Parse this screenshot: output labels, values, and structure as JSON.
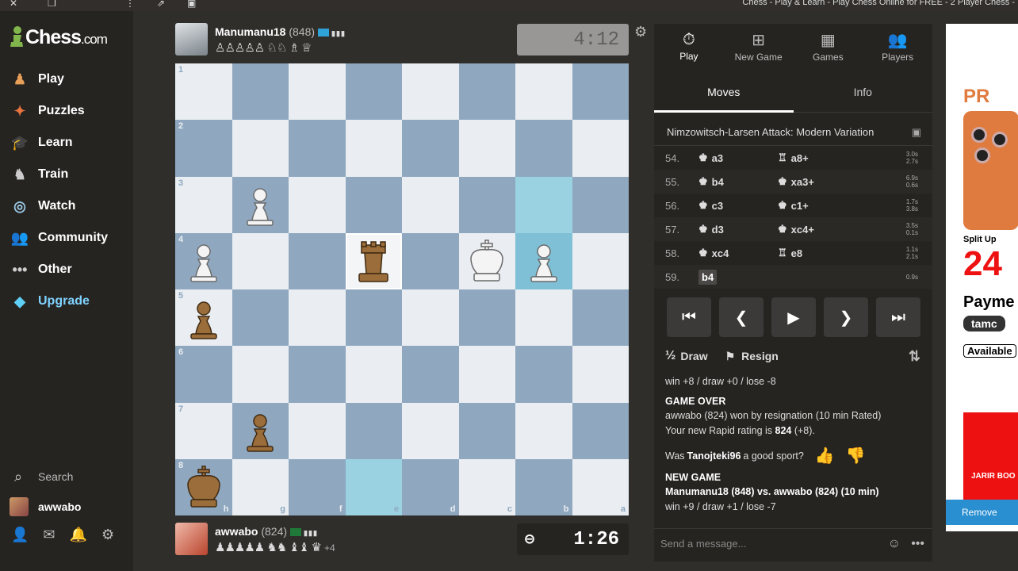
{
  "window": {
    "title": "Chess - Play & Learn - Play Chess Online for FREE - 2 Player Chess -"
  },
  "sidebar": {
    "brand": "Chess",
    "brand_suffix": ".com",
    "nav": [
      {
        "label": "Play",
        "icon": "play-icon"
      },
      {
        "label": "Puzzles",
        "icon": "puzzle-icon"
      },
      {
        "label": "Learn",
        "icon": "learn-icon"
      },
      {
        "label": "Train",
        "icon": "train-icon"
      },
      {
        "label": "Watch",
        "icon": "watch-icon"
      },
      {
        "label": "Community",
        "icon": "community-icon"
      },
      {
        "label": "Other",
        "icon": "more-icon"
      },
      {
        "label": "Upgrade",
        "icon": "diamond-icon"
      }
    ],
    "search_label": "Search",
    "username": "awwabo"
  },
  "top_player": {
    "name": "Manumanu18",
    "rating": "(848)",
    "captured": "♙♙♙♙♙ ♘♘ ♗ ♕"
  },
  "bottom_player": {
    "name": "awwabo",
    "rating": "(824)",
    "captured": "♟♟♟♟♟ ♞♞ ♝♝ ♛",
    "advantage": "+4"
  },
  "clocks": {
    "top": "4:12",
    "bottom": "1:26"
  },
  "board": {
    "ranks": [
      "1",
      "2",
      "3",
      "4",
      "5",
      "6",
      "7",
      "8"
    ],
    "files": [
      "h",
      "g",
      "f",
      "e",
      "d",
      "c",
      "b",
      "a"
    ],
    "pieces": [
      {
        "row": 2,
        "col": 1,
        "type": "pawn",
        "color": "white"
      },
      {
        "row": 3,
        "col": 0,
        "type": "pawn",
        "color": "white"
      },
      {
        "row": 3,
        "col": 3,
        "type": "rook",
        "color": "black"
      },
      {
        "row": 3,
        "col": 5,
        "type": "king",
        "color": "white"
      },
      {
        "row": 3,
        "col": 6,
        "type": "pawn",
        "color": "white"
      },
      {
        "row": 4,
        "col": 0,
        "type": "pawn",
        "color": "black"
      },
      {
        "row": 6,
        "col": 1,
        "type": "pawn",
        "color": "black"
      },
      {
        "row": 7,
        "col": 0,
        "type": "king",
        "color": "black"
      }
    ]
  },
  "panel": {
    "tabs": [
      {
        "label": "Play",
        "icon": "stopwatch-icon"
      },
      {
        "label": "New Game",
        "icon": "plus-icon"
      },
      {
        "label": "Games",
        "icon": "board-icon"
      },
      {
        "label": "Players",
        "icon": "players-icon"
      }
    ],
    "subtabs": [
      "Moves",
      "Info"
    ],
    "opening": "Nimzowitsch-Larsen Attack: Modern Variation",
    "moves": [
      {
        "num": "54.",
        "w_fig": "♚",
        "w": "a3",
        "b_fig": "♖",
        "b": "a8+",
        "t1": "3.0s",
        "t2": "2.7s"
      },
      {
        "num": "55.",
        "w_fig": "♚",
        "w": "b4",
        "b_fig": "♚",
        "b": "xa3+",
        "t1": "6.9s",
        "t2": "0.6s"
      },
      {
        "num": "56.",
        "w_fig": "♚",
        "w": "c3",
        "b_fig": "♚",
        "b": "c1+",
        "t1": "1.7s",
        "t2": "3.8s"
      },
      {
        "num": "57.",
        "w_fig": "♚",
        "w": "d3",
        "b_fig": "♚",
        "b": "xc4+",
        "t1": "3.5s",
        "t2": "0.1s"
      },
      {
        "num": "58.",
        "w_fig": "♚",
        "w": "xc4",
        "b_fig": "♖",
        "b": "e8",
        "t1": "1.1s",
        "t2": "2.1s"
      },
      {
        "num": "59.",
        "w_fig": "",
        "w": "b4",
        "b_fig": "",
        "b": "",
        "t1": "0.9s",
        "t2": ""
      }
    ],
    "draw_label": "Draw",
    "resign_label": "Resign",
    "chat": {
      "line1": "win +8 / draw +0 / lose -8",
      "game_over": "GAME OVER",
      "result": "awwabo (824) won by resignation (10 min Rated)",
      "rating_prefix": "Your new Rapid rating is ",
      "rating_value": "824",
      "rating_suffix": " (+8).",
      "sport_prefix": "Was ",
      "sport_name": "Tanojteki96",
      "sport_suffix": " a good sport?",
      "new_game": "NEW GAME",
      "new_game_line": "Manumanu18 (848) vs. awwabo (824) (10 min)",
      "new_game_stats": "win +9 / draw +1 / lose -7"
    },
    "message_placeholder": "Send a message..."
  },
  "ad": {
    "line1": "PR",
    "line2": "Split Up",
    "line3": "24",
    "line4": "Payme",
    "line5": "tamc",
    "line6": "Available",
    "brand": "JARIR BOO",
    "remove": "Remove"
  }
}
